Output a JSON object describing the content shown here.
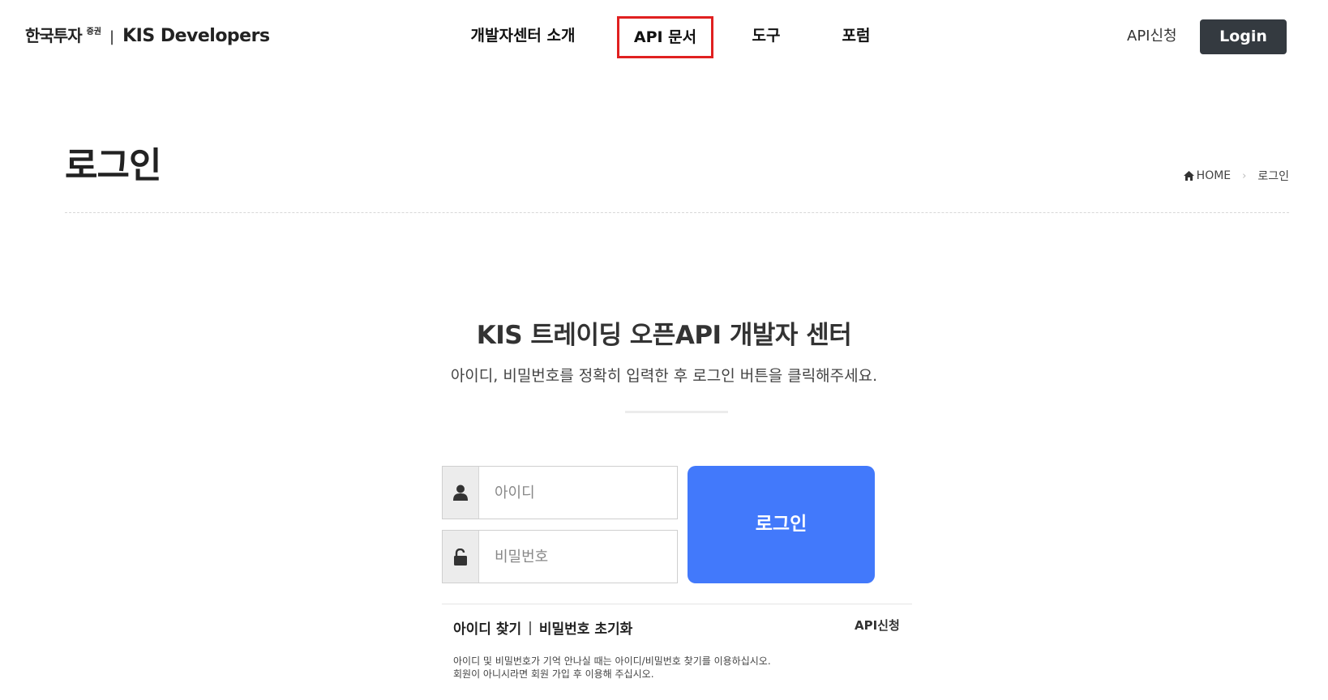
{
  "header": {
    "logo_company": "한국투자",
    "logo_sup": "증권",
    "logo_separator": "|",
    "logo_product": "KIS Developers",
    "nav": [
      {
        "label": "개발자센터 소개"
      },
      {
        "label": "API 문서"
      },
      {
        "label": "도구"
      },
      {
        "label": "포럼"
      }
    ],
    "active_nav": "API 문서",
    "apply_label": "API신청",
    "login_label": "Login"
  },
  "page": {
    "title": "로그인",
    "breadcrumb": {
      "home": "HOME",
      "arrow": "›",
      "current": "로그인"
    }
  },
  "login": {
    "heading": "KIS 트레이딩 오픈API 개발자 센터",
    "subheading": "아이디, 비밀번호를 정확히 입력한 후 로그인 버튼을 클릭해주세요.",
    "id_placeholder": "아이디",
    "password_placeholder": "비밀번호",
    "submit_label": "로그인",
    "find_id_label": "아이디 찾기",
    "links_separator": "|",
    "reset_password_label": "비밀번호 초기화",
    "apply_label": "API신청",
    "notice_line1": "아이디 및 비밀번호가 기억 안나실 때는 아이디/비밀번호 찾기를 이용하십시오.",
    "notice_line2": "회원이 아니시라면 회원 가입 후 이용해 주십시오."
  },
  "colors": {
    "accent": "#4279fb",
    "dark_button": "#343a40",
    "highlight_border": "#e02020"
  },
  "icons": [
    "home-icon",
    "user-icon",
    "unlock-icon"
  ]
}
